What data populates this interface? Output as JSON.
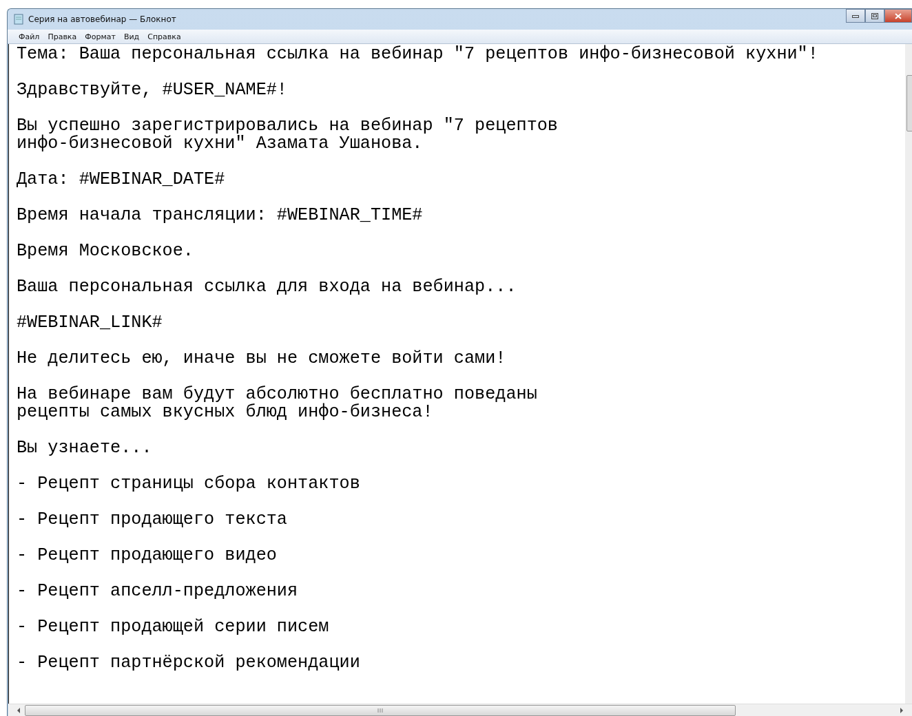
{
  "window": {
    "title": "Серия на автовебинар — Блокнот"
  },
  "menu": [
    "Файл",
    "Правка",
    "Формат",
    "Вид",
    "Справка"
  ],
  "paragraphs": [
    "Тема: Ваша персональная ссылка на вебинар \"7 рецептов инфо-бизнесовой кухни\"!",
    "Здравствуйте, #USER_NAME#!",
    "Вы успешно зарегистрировались на вебинар \"7 рецептов\nинфо-бизнесовой кухни\" Азамата Ушанова.",
    "Дата: #WEBINAR_DATE#",
    "Время начала трансляции: #WEBINAR_TIME#",
    "Время Московское.",
    "Ваша персональная ссылка для входа на вебинар...",
    "#WEBINAR_LINK#",
    "Не делитесь ею, иначе вы не сможете войти сами!",
    "На вебинаре вам будут абсолютно бесплатно поведаны\nрецепты самых вкусных блюд инфо-бизнеса!",
    "Вы узнаете...",
    "- Рецепт страницы сбора контактов",
    "- Рецепт продающего текста",
    "- Рецепт продающего видео",
    "- Рецепт апселл-предложения",
    "- Рецепт продающей серии писем",
    "- Рецепт партнёрской рекомендации"
  ]
}
